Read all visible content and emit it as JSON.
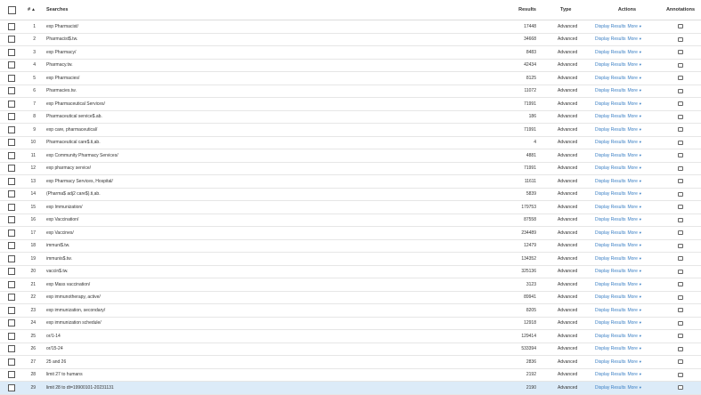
{
  "header": {
    "num_label": "#",
    "sort_icon": "▲",
    "searches_label": "Searches",
    "results_label": "Results",
    "type_label": "Type",
    "actions_label": "Actions",
    "annotations_label": "Annotations"
  },
  "rows": [
    {
      "num": "1",
      "search": "exp Pharmacist/",
      "results": "17448",
      "type": "Advanced",
      "action": "Display Results",
      "more": "More"
    },
    {
      "num": "2",
      "search": "Pharmacist$.tw.",
      "results": "34668",
      "type": "Advanced",
      "action": "Display Results",
      "more": "More"
    },
    {
      "num": "3",
      "search": "exp Pharmacy/",
      "results": "8483",
      "type": "Advanced",
      "action": "Display Results",
      "more": "More"
    },
    {
      "num": "4",
      "search": "Pharmacy.tw.",
      "results": "42434",
      "type": "Advanced",
      "action": "Display Results",
      "more": "More"
    },
    {
      "num": "5",
      "search": "exp Pharmacies/",
      "results": "8125",
      "type": "Advanced",
      "action": "Display Results",
      "more": "More"
    },
    {
      "num": "6",
      "search": "Pharmacies.tw.",
      "results": "11072",
      "type": "Advanced",
      "action": "Display Results",
      "more": "More"
    },
    {
      "num": "7",
      "search": "exp Pharmaceutical Services/",
      "results": "71991",
      "type": "Advanced",
      "action": "Display Results",
      "more": "More"
    },
    {
      "num": "8",
      "search": "Pharmaceutical service$.ab.",
      "results": "186",
      "type": "Advanced",
      "action": "Display Results",
      "more": "More"
    },
    {
      "num": "9",
      "search": "exp care, pharmaceutical/",
      "results": "71991",
      "type": "Advanced",
      "action": "Display Results",
      "more": "More"
    },
    {
      "num": "10",
      "search": "Pharmaceutical care$.ti,ab.",
      "results": "4",
      "type": "Advanced",
      "action": "Display Results",
      "more": "More"
    },
    {
      "num": "11",
      "search": "exp Community Pharmacy Services/",
      "results": "4881",
      "type": "Advanced",
      "action": "Display Results",
      "more": "More"
    },
    {
      "num": "12",
      "search": "exp pharmacy service/",
      "results": "71991",
      "type": "Advanced",
      "action": "Display Results",
      "more": "More"
    },
    {
      "num": "13",
      "search": "exp Pharmacy Services, Hospital/",
      "results": "11611",
      "type": "Advanced",
      "action": "Display Results",
      "more": "More"
    },
    {
      "num": "14",
      "search": "(Pharma$ adj2 care$).ti,ab.",
      "results": "5839",
      "type": "Advanced",
      "action": "Display Results",
      "more": "More"
    },
    {
      "num": "15",
      "search": "exp Immunization/",
      "results": "179753",
      "type": "Advanced",
      "action": "Display Results",
      "more": "More"
    },
    {
      "num": "16",
      "search": "exp Vaccination/",
      "results": "87558",
      "type": "Advanced",
      "action": "Display Results",
      "more": "More"
    },
    {
      "num": "17",
      "search": "exp Vaccines/",
      "results": "234489",
      "type": "Advanced",
      "action": "Display Results",
      "more": "More"
    },
    {
      "num": "18",
      "search": "immuni$.tw.",
      "results": "12479",
      "type": "Advanced",
      "action": "Display Results",
      "more": "More"
    },
    {
      "num": "19",
      "search": "immunis$.tw.",
      "results": "134352",
      "type": "Advanced",
      "action": "Display Results",
      "more": "More"
    },
    {
      "num": "20",
      "search": "vaccin$.tw.",
      "results": "325136",
      "type": "Advanced",
      "action": "Display Results",
      "more": "More"
    },
    {
      "num": "21",
      "search": "exp Mass vaccination/",
      "results": "3123",
      "type": "Advanced",
      "action": "Display Results",
      "more": "More"
    },
    {
      "num": "22",
      "search": "exp immunotherapy, active/",
      "results": "89941",
      "type": "Advanced",
      "action": "Display Results",
      "more": "More"
    },
    {
      "num": "23",
      "search": "exp immunization, secondary/",
      "results": "8205",
      "type": "Advanced",
      "action": "Display Results",
      "more": "More"
    },
    {
      "num": "24",
      "search": "exp immunization schedule/",
      "results": "12918",
      "type": "Advanced",
      "action": "Display Results",
      "more": "More"
    },
    {
      "num": "25",
      "search": "or/1-14",
      "results": "129414",
      "type": "Advanced",
      "action": "Display Results",
      "more": "More"
    },
    {
      "num": "26",
      "search": "or/15-24",
      "results": "533394",
      "type": "Advanced",
      "action": "Display Results",
      "more": "More"
    },
    {
      "num": "27",
      "search": "25 and 26",
      "results": "2836",
      "type": "Advanced",
      "action": "Display Results",
      "more": "More"
    },
    {
      "num": "28",
      "search": "limit 27 to humans",
      "results": "2192",
      "type": "Advanced",
      "action": "Display Results",
      "more": "More"
    },
    {
      "num": "29",
      "search": "limit 28 to dt=19900101-20231131",
      "results": "2190",
      "type": "Advanced",
      "action": "Display Results",
      "more": "More"
    }
  ],
  "selected_row": "29",
  "colors": {
    "link": "#3a7fc4",
    "selected_row_bg": "#dcebf8",
    "border": "#e6e6e6"
  }
}
